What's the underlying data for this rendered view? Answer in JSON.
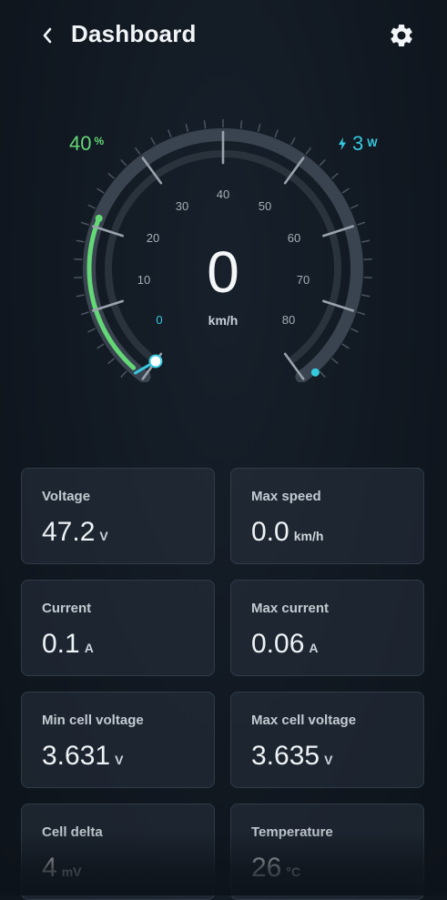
{
  "header": {
    "title": "Dashboard"
  },
  "gauge": {
    "battery_value": "40",
    "battery_unit": "%",
    "power_value": "3",
    "power_unit": "W",
    "speed_value": "0",
    "speed_unit": "km/h",
    "battery_level_percent": 40,
    "ticks": [
      "0",
      "10",
      "20",
      "30",
      "40",
      "50",
      "60",
      "70",
      "80"
    ],
    "accent_color": "#37c9e0",
    "battery_color": "#64d877"
  },
  "stats": [
    {
      "label": "Voltage",
      "value": "47.2",
      "unit": "V"
    },
    {
      "label": "Max speed",
      "value": "0.0",
      "unit": "km/h"
    },
    {
      "label": "Current",
      "value": "0.1",
      "unit": "A"
    },
    {
      "label": "Max current",
      "value": "0.06",
      "unit": "A"
    },
    {
      "label": "Min cell voltage",
      "value": "3.631",
      "unit": "V"
    },
    {
      "label": "Max cell voltage",
      "value": "3.635",
      "unit": "V"
    },
    {
      "label": "Cell delta",
      "value": "4",
      "unit": "mV"
    },
    {
      "label": "Temperature",
      "value": "26",
      "unit": "°C"
    }
  ],
  "icons": {
    "back": "chevron-left-icon",
    "settings": "gear-icon",
    "power": "bolt-icon"
  }
}
